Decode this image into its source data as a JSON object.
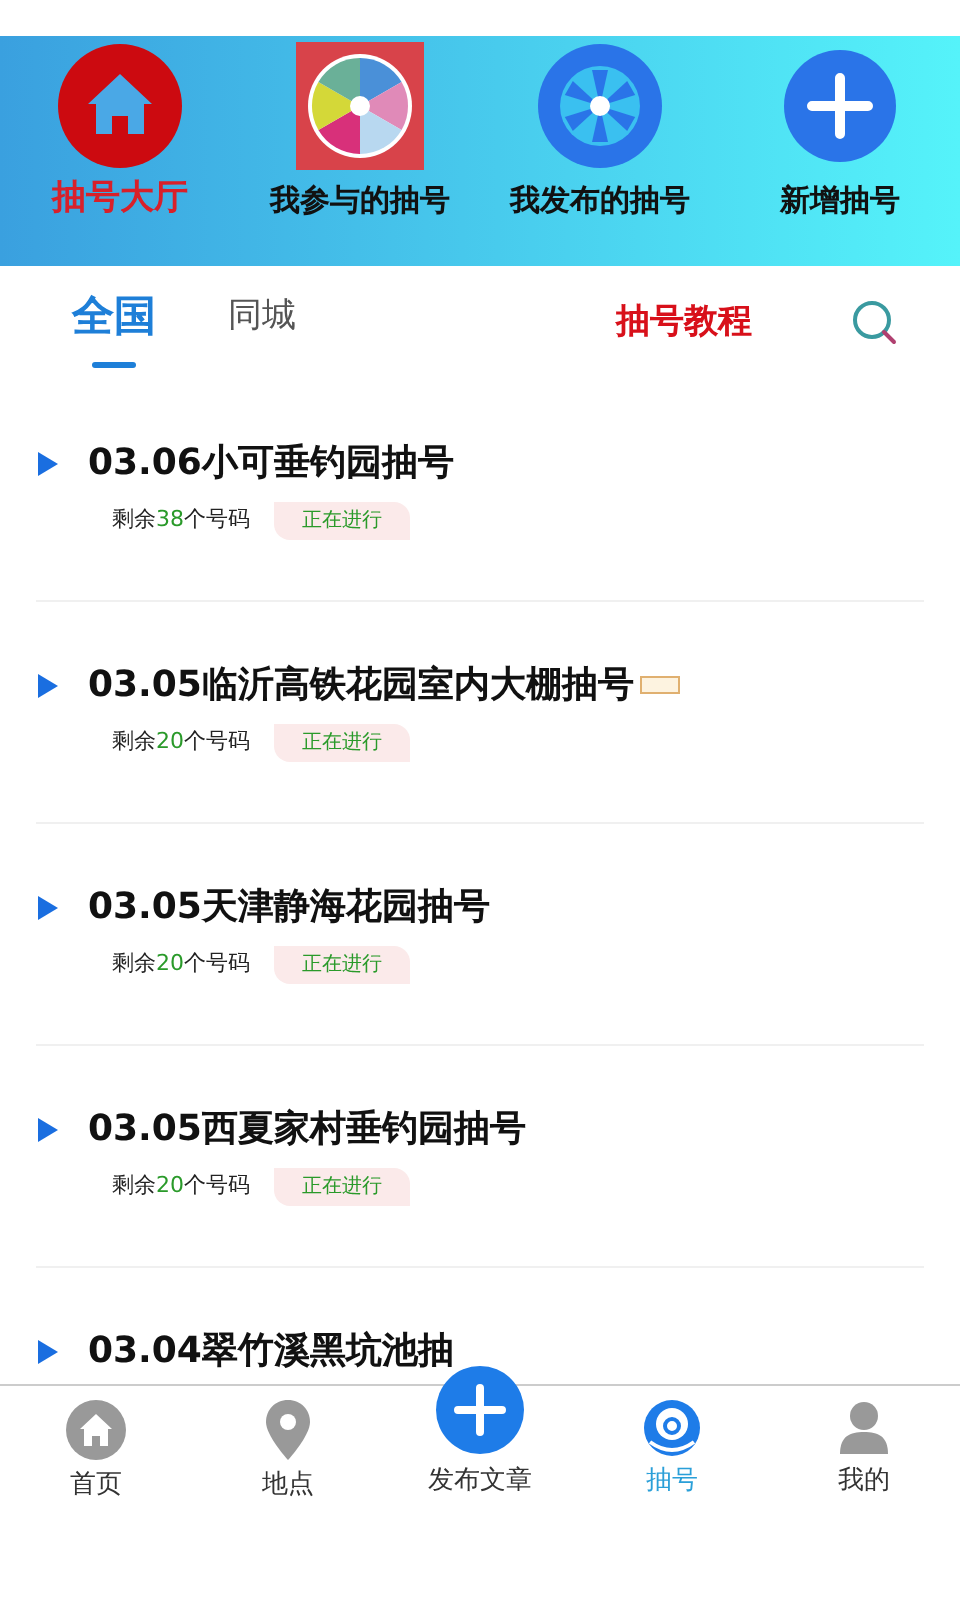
{
  "header_menu": [
    {
      "label": "抽号大厅",
      "kind": "home",
      "selected": true
    },
    {
      "label": "我参与的抽号",
      "kind": "wheel",
      "selected": false
    },
    {
      "label": "我发布的抽号",
      "kind": "fan",
      "selected": false
    },
    {
      "label": "新增抽号",
      "kind": "plus",
      "selected": false
    }
  ],
  "tabs": [
    {
      "label": "全国",
      "selected": true
    },
    {
      "label": "同城",
      "selected": false
    }
  ],
  "tutorial_link": "抽号教程",
  "draws": [
    {
      "title": "03.06小可垂钓园抽号",
      "verified": false,
      "remaining_prefix": "剩余",
      "count": "38",
      "remaining_suffix": "个号码",
      "status": "正在进行"
    },
    {
      "title": "03.05临沂高铁花园室内大棚抽号",
      "verified": true,
      "remaining_prefix": "剩余",
      "count": "20",
      "remaining_suffix": "个号码",
      "status": "正在进行"
    },
    {
      "title": "03.05天津静海花园抽号",
      "verified": false,
      "remaining_prefix": "剩余",
      "count": "20",
      "remaining_suffix": "个号码",
      "status": "正在进行"
    },
    {
      "title": "03.05西夏家村垂钓园抽号",
      "verified": false,
      "remaining_prefix": "剩余",
      "count": "20",
      "remaining_suffix": "个号码",
      "status": "正在进行"
    },
    {
      "title": "03.04翠竹溪黑坑池抽"
    }
  ],
  "bottom_nav": [
    {
      "label": "首页",
      "kind": "home",
      "selected": false
    },
    {
      "label": "地点",
      "kind": "pin",
      "selected": false
    },
    {
      "label": "发布文章",
      "kind": "fab",
      "selected": false
    },
    {
      "label": "抽号",
      "kind": "ball",
      "selected": true
    },
    {
      "label": "我的",
      "kind": "person",
      "selected": false
    }
  ]
}
